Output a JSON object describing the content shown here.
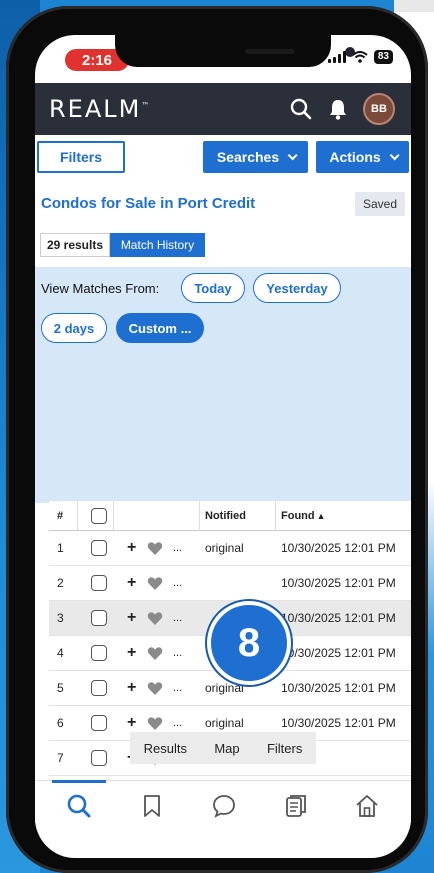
{
  "status_bar": {
    "time": "2:16",
    "battery": "83"
  },
  "header": {
    "logo": "REALM",
    "logo_mark": "™",
    "avatar_initials": "BB"
  },
  "toolbar": {
    "filters_label": "Filters",
    "searches_label": "Searches",
    "actions_label": "Actions"
  },
  "search": {
    "title": "Condos for Sale in Port Credit",
    "saved_label": "Saved"
  },
  "segments": {
    "results_label": "29 results",
    "history_label": "Match History"
  },
  "view_matches": {
    "label": "View Matches From:",
    "options": [
      "Today",
      "Yesterday",
      "2 days",
      "Custom ..."
    ],
    "selected": "Custom ..."
  },
  "table": {
    "headers": {
      "num": "#",
      "notified": "Notified",
      "found": "Found"
    },
    "rows": [
      {
        "num": "1",
        "notified": "original",
        "found": "10/30/2025 12:01 PM"
      },
      {
        "num": "2",
        "notified": "",
        "found": "10/30/2025 12:01 PM"
      },
      {
        "num": "3",
        "notified": "",
        "found": "10/30/2025 12:01 PM"
      },
      {
        "num": "4",
        "notified": "",
        "found": "10/30/2025 12:01 PM"
      },
      {
        "num": "5",
        "notified": "original",
        "found": "10/30/2025 12:01 PM"
      },
      {
        "num": "6",
        "notified": "original",
        "found": "10/30/2025 12:01 PM"
      },
      {
        "num": "7",
        "notified": "",
        "found": ""
      }
    ],
    "row_plus": "+",
    "row_more": "..."
  },
  "overlay_badge": "8",
  "floatbar": {
    "results": "Results",
    "map": "Map",
    "filters": "Filters"
  },
  "colors": {
    "accent": "#1f6fd0",
    "header_bg": "#2b2f3a",
    "panel_bg": "#d6e7f8",
    "time_pill": "#e0332f"
  }
}
